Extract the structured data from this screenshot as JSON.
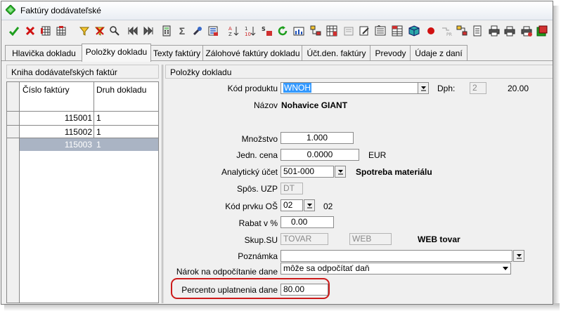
{
  "window": {
    "title": "Faktúry dodávateľské"
  },
  "toolbar": {
    "icons": [
      "confirm-check-icon",
      "cancel-x-icon",
      "table-view-icon",
      "delete-table-icon",
      "filter-icon",
      "filter-remove-icon",
      "find-icon",
      "first-record-icon",
      "last-record-icon",
      "calculator-icon",
      "sum-icon",
      "tools-icon",
      "report-icon",
      "sort-az-icon",
      "sort-numeric-icon",
      "sort-sql-icon",
      "refresh-icon",
      "chart-icon",
      "tree-icon",
      "grid-icon",
      "form-icon",
      "edit-icon",
      "list-icon",
      "table-icon",
      "cube-icon",
      "record-icon",
      "pr-icon",
      "columns-icon",
      "note-icon",
      "print-icon",
      "print-preview-icon",
      "print-setup-icon",
      "export-icon"
    ]
  },
  "tabs": [
    {
      "label": "Hlavička dokladu"
    },
    {
      "label": "Položky dokladu"
    },
    {
      "label": "Texty faktúry"
    },
    {
      "label": "Zálohové faktúry dokladu"
    },
    {
      "label": "Účt.den. faktúry"
    },
    {
      "label": "Prevody"
    },
    {
      "label": "Údaje z daní"
    }
  ],
  "left_panel": {
    "title": "Kniha dodávateľských faktúr",
    "columns": [
      "Číslo faktúry",
      "Druh dokladu"
    ],
    "rows": [
      {
        "cislo": "115001",
        "druh": "1"
      },
      {
        "cislo": "115002",
        "druh": "1"
      },
      {
        "cislo": "115003",
        "druh": "1"
      }
    ]
  },
  "form": {
    "title": "Položky dokladu",
    "kod_produktu": {
      "label": "Kód produktu",
      "value": "WNOH"
    },
    "dph": {
      "label": "Dph:",
      "value": "2",
      "rate": "20.00"
    },
    "nazov": {
      "label": "Názov",
      "value": "Nohavice GIANT"
    },
    "mnozstvo": {
      "label": "Množstvo",
      "value": "1.000"
    },
    "jedn_cena": {
      "label": "Jedn. cena",
      "value": "0.0000",
      "currency": "EUR"
    },
    "analyticky_ucet": {
      "label": "Analytický účet",
      "value": "501-000",
      "name": "Spotreba materiálu"
    },
    "spos_uzp": {
      "label": "Spôs. UZP",
      "value": "DT"
    },
    "kod_prvku": {
      "label": "Kód prvku OŠ",
      "value": "02",
      "display": "02"
    },
    "rabat": {
      "label": "Rabat v %",
      "value": "0.00"
    },
    "skup_su": {
      "label": "Skup.SU",
      "value": "TOVAR",
      "value2": "WEB",
      "name": "WEB tovar"
    },
    "poznamka": {
      "label": "Poznámka",
      "value": ""
    },
    "narok": {
      "label": "Nárok na odpočítanie dane",
      "value": "môže sa odpočítať daň"
    },
    "percento": {
      "label": "Percento uplatnenia dane",
      "value": "80.00"
    }
  },
  "colors": {
    "selection": "#3399ff",
    "highlight_ring": "#cc1b1b",
    "selected_row": "#aab4c4"
  }
}
